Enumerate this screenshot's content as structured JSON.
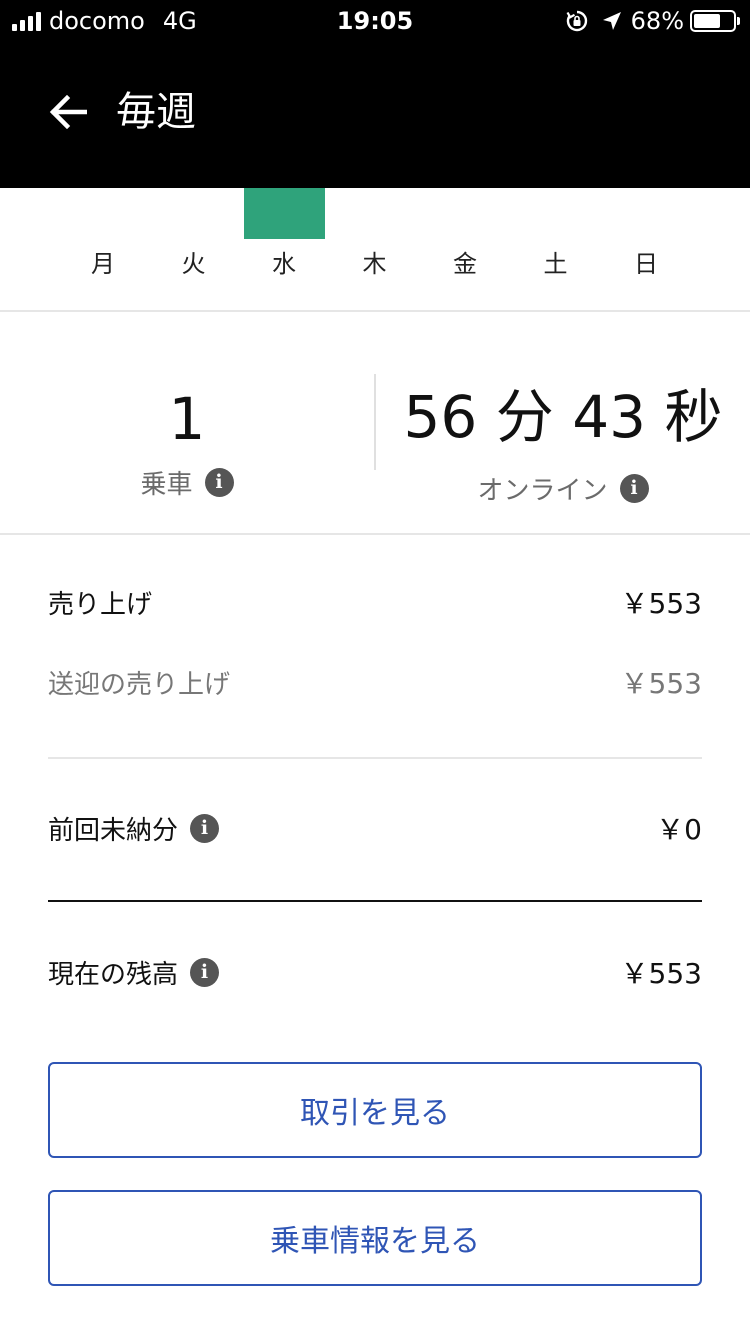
{
  "status_bar": {
    "carrier": "docomo",
    "network": "4G",
    "time": "19:05",
    "battery_percent": "68%",
    "battery_level": 0.68
  },
  "header": {
    "title": "毎週"
  },
  "week_chart": {
    "days": [
      "月",
      "火",
      "水",
      "木",
      "金",
      "土",
      "日"
    ],
    "values": [
      0,
      0,
      1,
      0,
      0,
      0,
      0
    ],
    "bar_color": "#2fa37b"
  },
  "stats": {
    "rides_value": "1",
    "rides_label": "乗車",
    "online_value": "56 分 43 秒",
    "online_label": "オンライン"
  },
  "earnings": {
    "sales_label": "売り上げ",
    "sales_value": "￥553",
    "pickup_sales_label": "送迎の売り上げ",
    "pickup_sales_value": "￥553",
    "previous_unpaid_label": "前回未納分",
    "previous_unpaid_value": "￥0",
    "current_balance_label": "現在の残高",
    "current_balance_value": "￥553"
  },
  "buttons": {
    "view_transactions": "取引を見る",
    "view_rides": "乗車情報を見る"
  },
  "colors": {
    "accent": "#2f55b5",
    "header_bg": "#000000",
    "bar": "#2fa37b"
  }
}
